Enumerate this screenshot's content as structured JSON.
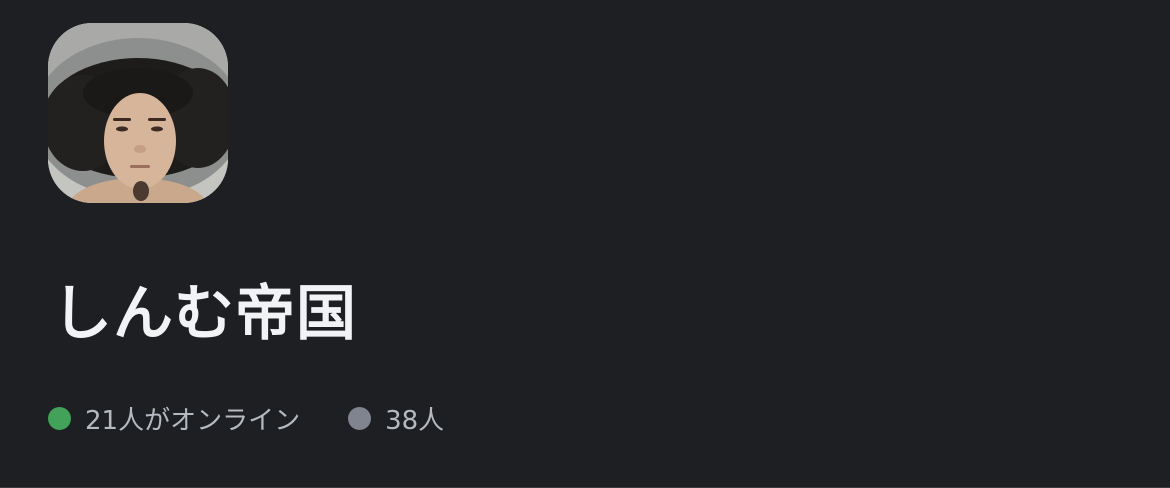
{
  "server": {
    "name": "しんむ帝国",
    "icon": "server-avatar-photo"
  },
  "stats": {
    "online_text": "21人がオンライン",
    "members_text": "38人"
  },
  "colors": {
    "background": "#1e1f22",
    "online_dot": "#43a25a",
    "members_dot": "#80848e",
    "title_text": "#f2f3f5",
    "stat_text": "#b5bac1"
  }
}
